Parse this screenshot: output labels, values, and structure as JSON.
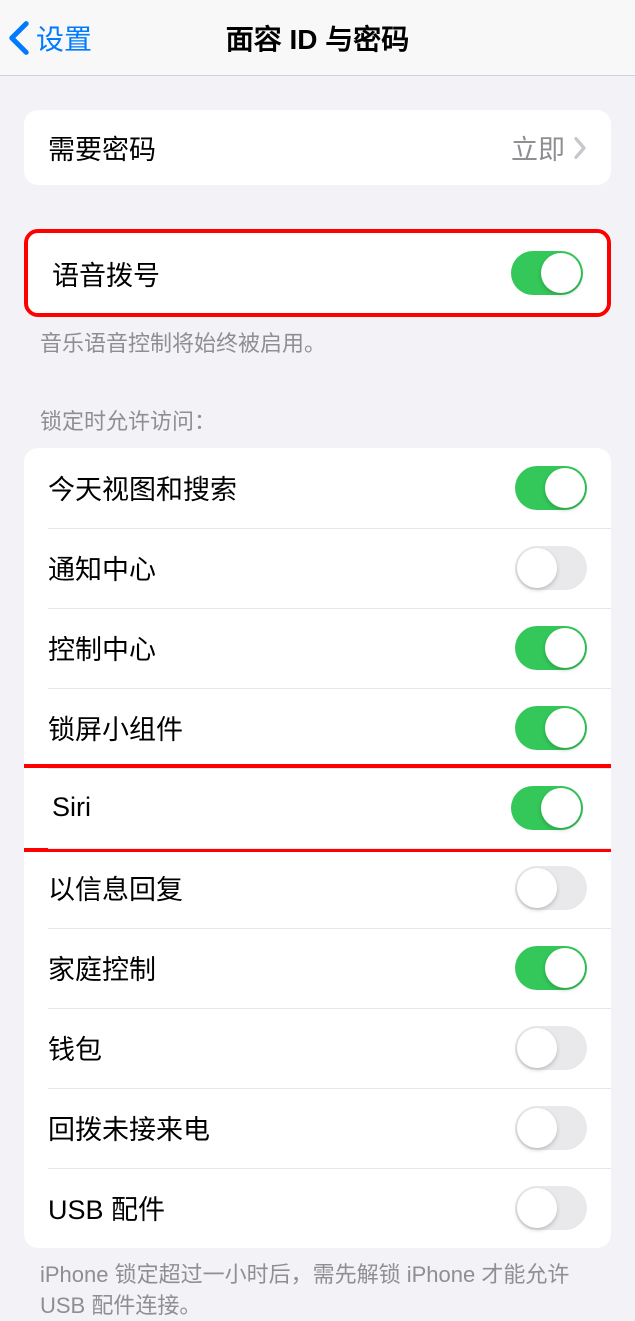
{
  "nav": {
    "back_label": "设置",
    "title": "面容 ID 与密码"
  },
  "section_passcode": {
    "label": "需要密码",
    "value": "立即"
  },
  "section_voice": {
    "label": "语音拨号",
    "toggle_on": true,
    "footer": "音乐语音控制将始终被启用。"
  },
  "section_locked": {
    "header": "锁定时允许访问：",
    "items": [
      {
        "label": "今天视图和搜索",
        "on": true
      },
      {
        "label": "通知中心",
        "on": false
      },
      {
        "label": "控制中心",
        "on": true
      },
      {
        "label": "锁屏小组件",
        "on": true
      },
      {
        "label": "Siri",
        "on": true
      },
      {
        "label": "以信息回复",
        "on": false
      },
      {
        "label": "家庭控制",
        "on": true
      },
      {
        "label": "钱包",
        "on": false
      },
      {
        "label": "回拨未接来电",
        "on": false
      },
      {
        "label": "USB 配件",
        "on": false
      }
    ],
    "footer": "iPhone 锁定超过一小时后，需先解锁 iPhone 才能允许 USB 配件连接。"
  }
}
